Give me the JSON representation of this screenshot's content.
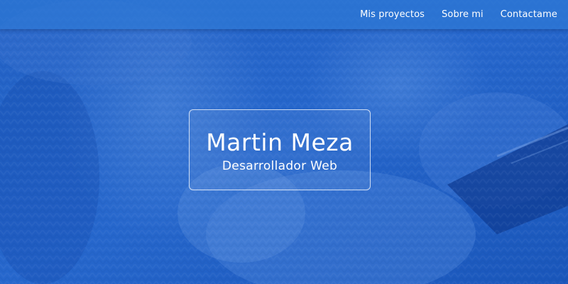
{
  "nav": {
    "links": [
      {
        "label": "Mis proyectos"
      },
      {
        "label": "Sobre mi"
      },
      {
        "label": "Contactame"
      }
    ]
  },
  "hero": {
    "name": "Martin Meza",
    "role": "Desarrollador Web",
    "overlay_color": "#1f5fc0"
  }
}
